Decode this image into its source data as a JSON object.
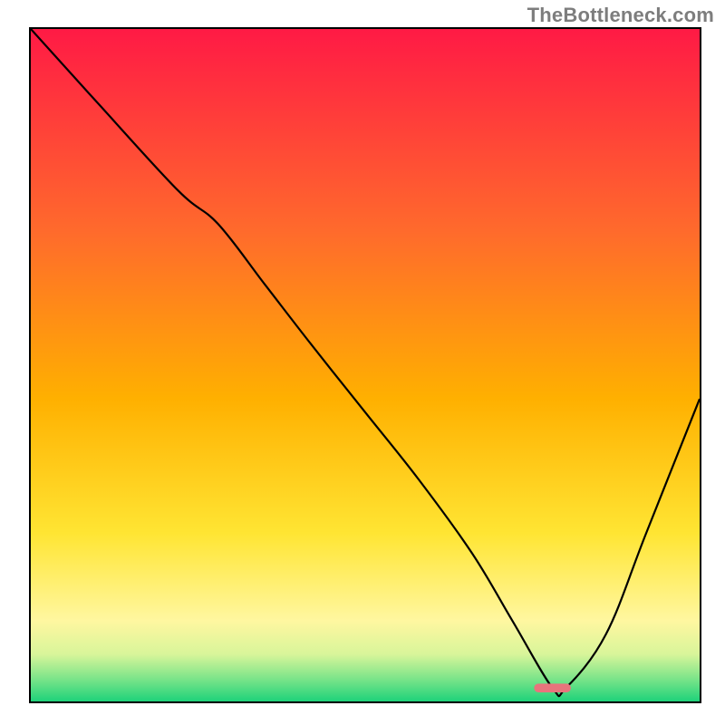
{
  "watermark": "TheBottleneck.com",
  "chart_data": {
    "type": "line",
    "title": "",
    "xlabel": "",
    "ylabel": "",
    "xlim": [
      0,
      100
    ],
    "ylim": [
      0,
      100
    ],
    "grid": false,
    "legend": false,
    "gradient_stops": [
      {
        "offset": 0.0,
        "color": "#ff1a45"
      },
      {
        "offset": 0.3,
        "color": "#ff6a2c"
      },
      {
        "offset": 0.55,
        "color": "#ffb000"
      },
      {
        "offset": 0.75,
        "color": "#ffe533"
      },
      {
        "offset": 0.88,
        "color": "#fff7a0"
      },
      {
        "offset": 0.93,
        "color": "#d8f59a"
      },
      {
        "offset": 0.965,
        "color": "#7fe58a"
      },
      {
        "offset": 1.0,
        "color": "#1ed27a"
      }
    ],
    "series": [
      {
        "name": "curve",
        "color": "#000000",
        "x": [
          0,
          10,
          22,
          28,
          35,
          42,
          50,
          58,
          66,
          72,
          78,
          80,
          86,
          92,
          100
        ],
        "y": [
          100,
          89,
          76,
          71,
          62,
          53,
          43,
          33,
          22,
          12,
          2,
          2,
          10,
          25,
          45
        ]
      }
    ],
    "marker": {
      "x": 78,
      "y": 2,
      "width_pct": 5.5,
      "height_pct": 1.3,
      "color": "#e8747c"
    }
  }
}
